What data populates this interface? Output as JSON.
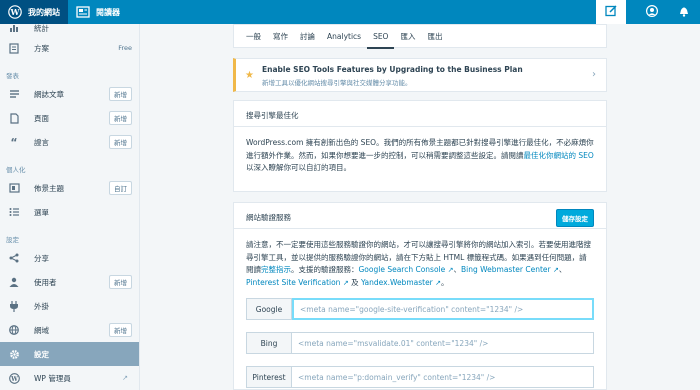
{
  "masterbar": {
    "my_sites": "我的網站",
    "reader": "閱讀器"
  },
  "sidebar": {
    "top_item": "統計",
    "plan": {
      "label": "方案",
      "tag": "Free"
    },
    "heading_publish": "發表",
    "posts": {
      "label": "網誌文章",
      "badge": "新增"
    },
    "pages": {
      "label": "頁面",
      "badge": "新增"
    },
    "testimonials": {
      "label": "證言",
      "badge": "新增"
    },
    "heading_personalize": "個人化",
    "themes": {
      "label": "佈景主題",
      "badge": "自訂"
    },
    "menus": {
      "label": "選單"
    },
    "heading_configure": "設定",
    "sharing": {
      "label": "分享"
    },
    "people": {
      "label": "使用者",
      "badge": "新增"
    },
    "plugins": {
      "label": "外掛"
    },
    "domains": {
      "label": "網域",
      "badge": "新增"
    },
    "settings": {
      "label": "設定"
    },
    "wp_admin": {
      "label": "WP 管理員"
    }
  },
  "tabs": [
    "一般",
    "寫作",
    "討論",
    "Analytics",
    "SEO",
    "匯入",
    "匯出"
  ],
  "upsell": {
    "title": "Enable SEO Tools Features by Upgrading to the Business Plan",
    "subtitle": "新增工具以優化網站搜尋引擎與社交媒體分享功能。"
  },
  "seo_section": {
    "header": "搜尋引擎最佳化",
    "text_a": "WordPress.com 擁有創新出色的 SEO。我們的所有佈景主題都已針對搜尋引擎進行最佳化，不必麻煩你進行額外作業。然而，如果你想要進一步的控制，可以稍需要調整這些設定。請閱讀",
    "link": "最佳化你網站的 SEO",
    "text_b": " 以深入瞭解你可以自訂的項目。"
  },
  "verify_section": {
    "header": "網站驗證服務",
    "save_button": "儲存設定",
    "text_a": "請注意，不一定要使用這些服務驗證你的網站，才可以讓搜尋引擎將你的網站加入索引。若要使用進階搜尋引擎工具，並以提供的服務驗證你的網站，請在下方貼上 HTML 標籤程式碼。如果遇到任何問題，請閱讀",
    "guide_link": "完整指示",
    "text_b": "。支援的驗證服務：",
    "services": [
      "Google Search Console",
      "Bing Webmaster Center",
      "Pinterest Site Verification",
      "Yandex.Webmaster"
    ],
    "sep1": "、",
    "sep2": "、",
    "and": " 及 ",
    "end": "。"
  },
  "verify_fields": [
    {
      "label": "Google",
      "placeholder": "<meta name=\"google-site-verification\" content=\"1234\" />"
    },
    {
      "label": "Bing",
      "placeholder": "<meta name=\"msvalidate.01\" content=\"1234\" />"
    },
    {
      "label": "Pinterest",
      "placeholder": "<meta name=\"p:domain_verify\" content=\"1234\" />"
    }
  ],
  "colors": {
    "brand": "#0087be",
    "accent": "#00aadc",
    "upsell": "#f0b849",
    "selected": "#87a6bc"
  }
}
